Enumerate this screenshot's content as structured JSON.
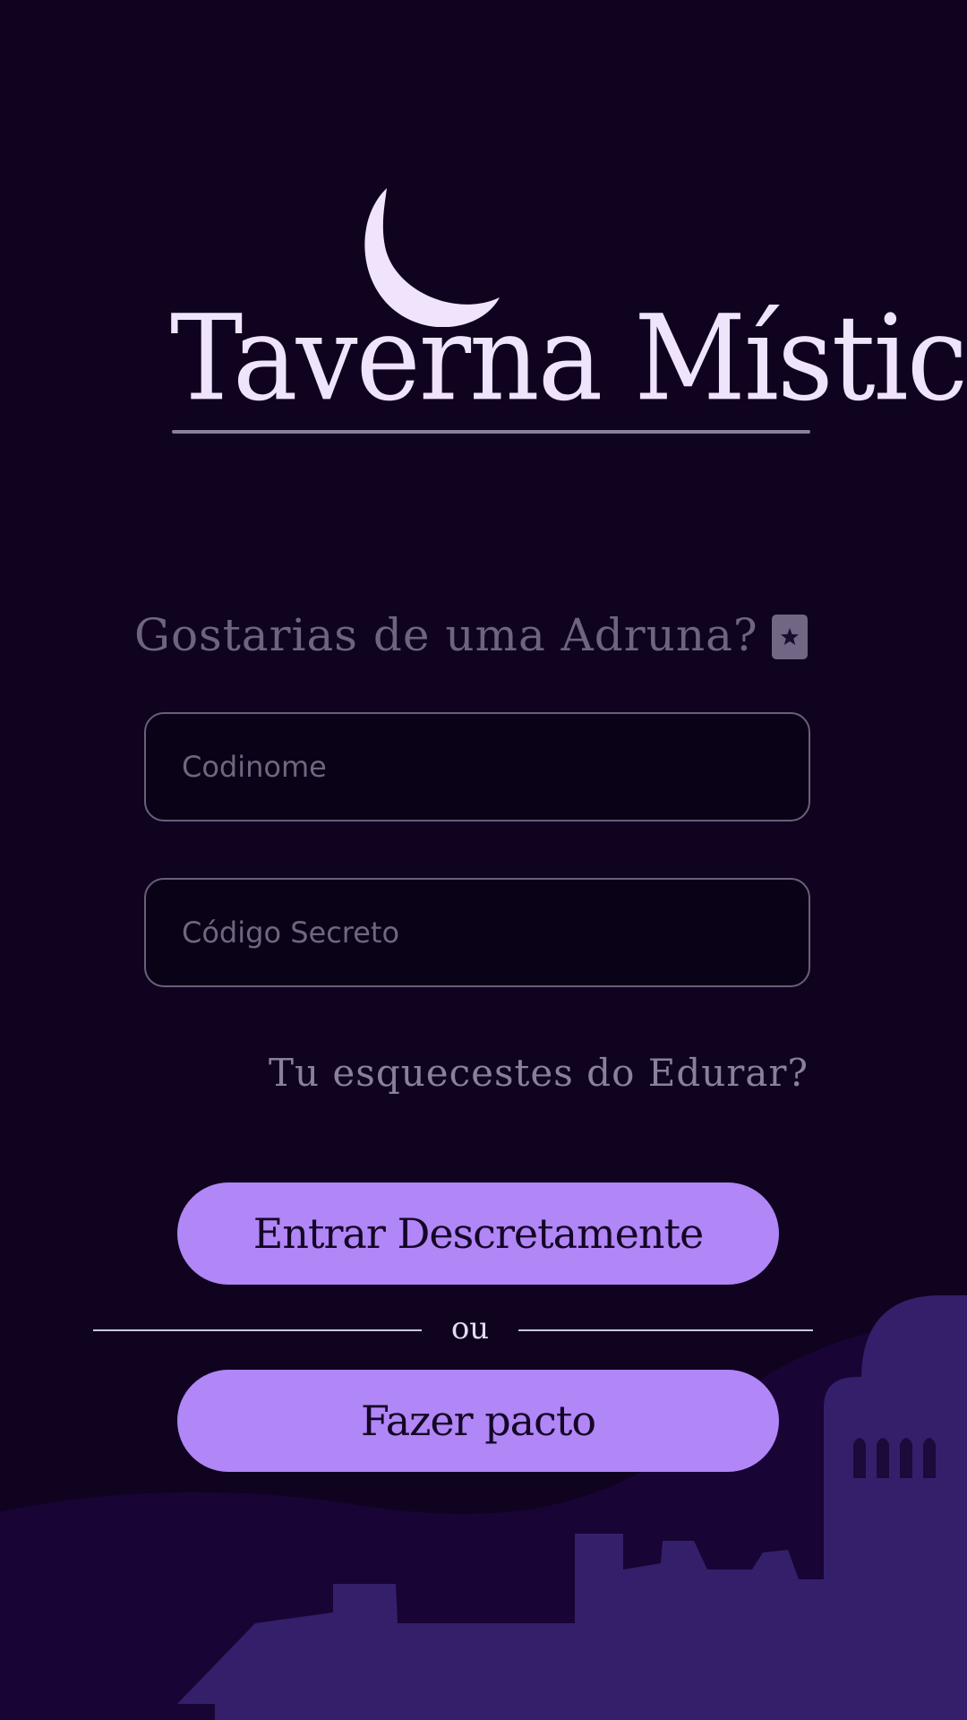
{
  "app": {
    "title": "Taverna Mística"
  },
  "login": {
    "prompt": "Gostarias de uma Adruna?",
    "prompt_icon": "star-card-icon",
    "username_placeholder": "Codinome",
    "password_placeholder": "Código Secreto",
    "forgot_link": "Tu esquecestes do Edurar?",
    "enter_button": "Entrar Descretamente",
    "divider_text": "ou",
    "signup_button": "Fazer pacto"
  },
  "colors": {
    "background": "#0f0320",
    "accent": "#b186f6",
    "logo_text": "#efe4fb",
    "muted_text": "#6e6480",
    "skyline": "#34206a",
    "hill": "#190436"
  }
}
